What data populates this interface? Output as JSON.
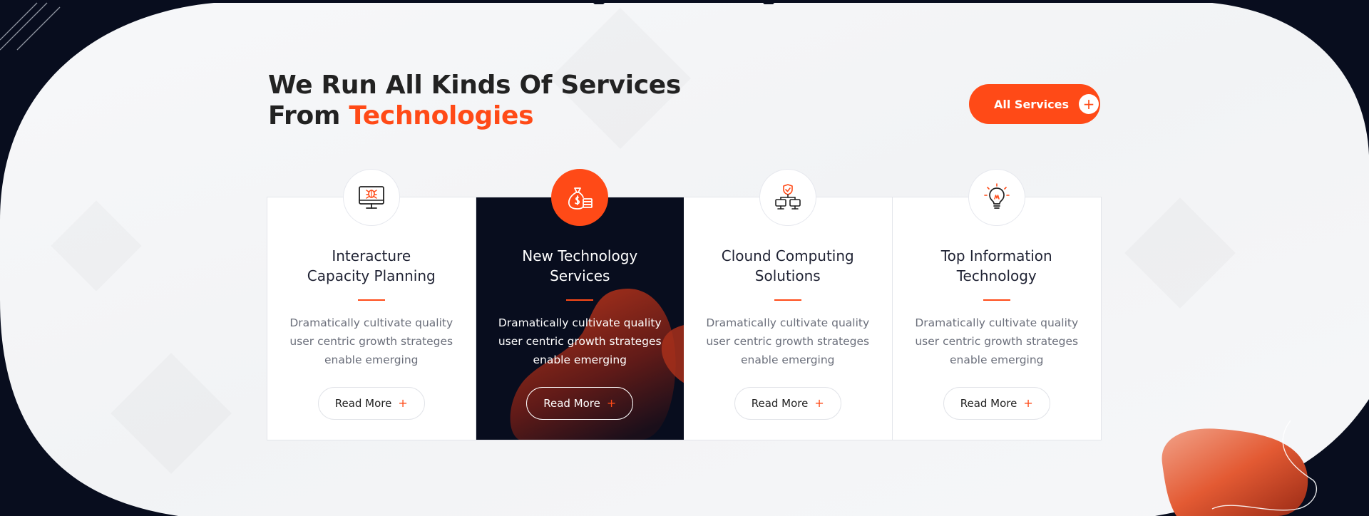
{
  "section": {
    "heading_line1": "We Run All Kinds Of Services",
    "heading_line2_prefix": "From ",
    "heading_accent": "Technologies",
    "all_services_label": "All Services",
    "plus_glyph": "+"
  },
  "colors": {
    "accent": "#ff4a17",
    "dark": "#080d1e",
    "text": "#222222",
    "muted": "#6b6f7b"
  },
  "cards": [
    {
      "icon": "monitor-bug-icon",
      "title_line1": "Interacture",
      "title_line2": "Capacity Planning",
      "desc": "Dramatically cultivate quality user centric growth strateges enable emerging",
      "button_label": "Read More",
      "active": false
    },
    {
      "icon": "money-bag-icon",
      "title_line1": "New Technology",
      "title_line2": "Services",
      "desc": "Dramatically cultivate quality user centric growth strateges enable emerging",
      "button_label": "Read More",
      "active": true
    },
    {
      "icon": "network-shield-icon",
      "title_line1": "Clound Computing",
      "title_line2": "Solutions",
      "desc": "Dramatically cultivate quality user centric growth strateges enable emerging",
      "button_label": "Read More",
      "active": false
    },
    {
      "icon": "lightbulb-icon",
      "title_line1": "Top Information",
      "title_line2": "Technology",
      "desc": "Dramatically cultivate quality user centric growth strateges enable emerging",
      "button_label": "Read More",
      "active": false
    }
  ]
}
